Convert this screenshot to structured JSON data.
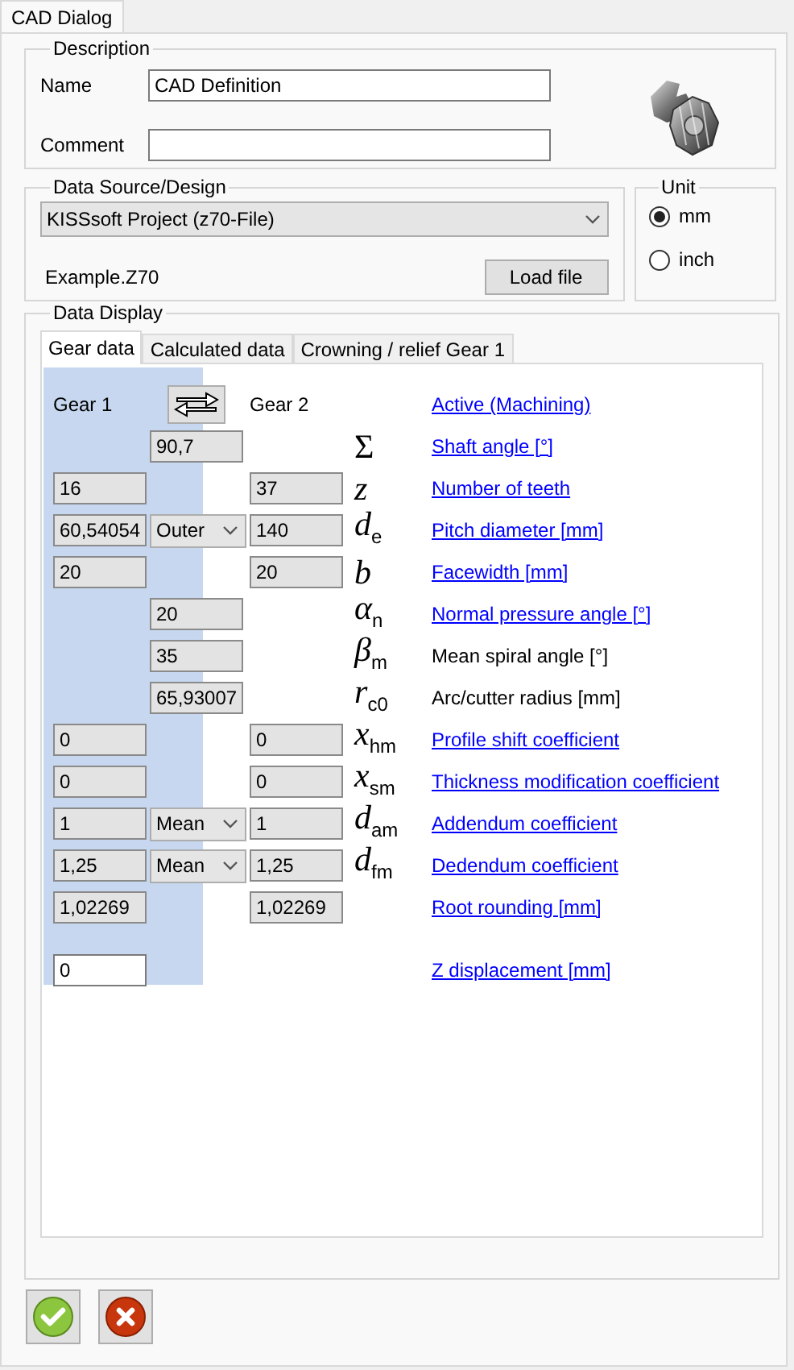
{
  "window_tabs": [
    {
      "label": "CAD Dialog",
      "selected": true
    }
  ],
  "description": {
    "title": "Description",
    "name_label": "Name",
    "name_value": "CAD Definition",
    "comment_label": "Comment"
  },
  "data_source": {
    "title": "Data Source/Design",
    "selection": "KISSsoft Project (z70-File)",
    "file_name": "Example.Z70",
    "load_button": "Load file"
  },
  "unit": {
    "title": "Unit",
    "options": [
      {
        "label": "mm",
        "selected": true
      },
      {
        "label": "inch",
        "selected": false
      }
    ]
  },
  "data_display": {
    "title": "Data Display",
    "tabs": [
      {
        "label": "Gear data",
        "selected": true
      },
      {
        "label": "Calculated data",
        "selected": false
      },
      {
        "label": "Crowning / relief Gear 1",
        "selected": false
      }
    ],
    "header": {
      "gear1": "Gear 1",
      "gear2": "Gear 2",
      "link": "Active (Machining)"
    },
    "rows": [
      {
        "middle": {
          "kind": "field",
          "value": "90,7"
        },
        "symbol": "Σ",
        "label": "Shaft angle [°]",
        "link": true,
        "disabled": true,
        "separated": false
      },
      {
        "gear1": "16",
        "gear2": "37",
        "symbol": "*z*",
        "label": "Number of teeth",
        "link": true,
        "disabled": true,
        "separated": false
      },
      {
        "gear1": "60,54054",
        "middle": {
          "kind": "select",
          "value": "Outer"
        },
        "gear2": "140",
        "symbol": "*d*$_{e}$",
        "label": "Pitch diameter [mm]",
        "link": true,
        "disabled": true,
        "separated": false
      },
      {
        "gear1": "20",
        "gear2": "20",
        "symbol": "*b*",
        "label": "Facewidth [mm]",
        "link": true,
        "disabled": true,
        "separated": false
      },
      {
        "middle": {
          "kind": "field",
          "value": "20"
        },
        "symbol": "*α*$_{n}$",
        "label": "Normal pressure angle [°]",
        "link": true,
        "disabled": true,
        "separated": false
      },
      {
        "middle": {
          "kind": "field",
          "value": "35"
        },
        "symbol": "*β*$_{m}$",
        "label": "Mean spiral angle [°]",
        "link": false,
        "disabled": true,
        "separated": false
      },
      {
        "middle": {
          "kind": "field",
          "value": "65,93007"
        },
        "symbol": "*r*$_{c0}$",
        "label": "Arc/cutter radius [mm]",
        "link": false,
        "disabled": true,
        "separated": false
      },
      {
        "gear1": "0",
        "gear2": "0",
        "symbol": "*x*$_{hm}$",
        "label": "Profile shift coefficient",
        "link": true,
        "disabled": true,
        "separated": false
      },
      {
        "gear1": "0",
        "gear2": "0",
        "symbol": "*x*$_{sm}$",
        "label": "Thickness modification coefficient",
        "link": true,
        "disabled": true,
        "separated": false
      },
      {
        "gear1": "1",
        "middle": {
          "kind": "select",
          "value": "Mean"
        },
        "gear2": "1",
        "symbol": "*d*$_{am}$",
        "label": "Addendum coefficient",
        "link": true,
        "disabled": true,
        "separated": false
      },
      {
        "gear1": "1,25",
        "middle": {
          "kind": "select",
          "value": "Mean"
        },
        "gear2": "1,25",
        "symbol": "*d*$_{fm}$",
        "label": "Dedendum coefficient",
        "link": true,
        "disabled": true,
        "separated": false
      },
      {
        "gear1": "1,02269",
        "gear2": "1,02269",
        "label": "Root rounding [mm]",
        "link": true,
        "disabled": true,
        "separated": false
      },
      {
        "gear1": "0",
        "label": "Z displacement [mm]",
        "link": true,
        "disabled": false,
        "separated": true
      }
    ]
  }
}
